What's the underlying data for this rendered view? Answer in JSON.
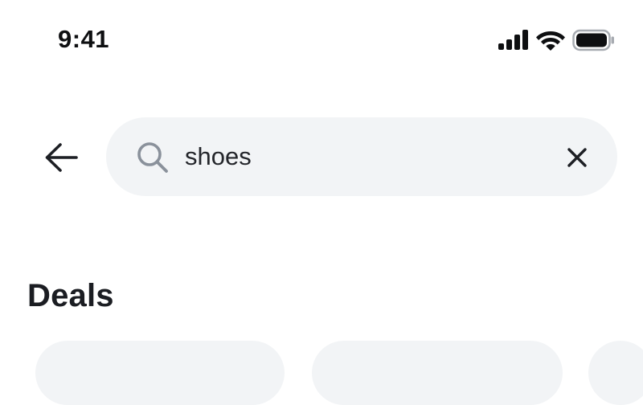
{
  "status_bar": {
    "time": "9:41",
    "icons": [
      "cellular-signal-icon",
      "wifi-icon",
      "battery-icon"
    ]
  },
  "search": {
    "query": "shoes",
    "icons": {
      "back": "back-arrow-icon",
      "search": "search-icon",
      "clear": "close-icon"
    }
  },
  "deals": {
    "title": "Deals"
  },
  "colors": {
    "search_bg": "#f2f4f6",
    "search_icon": "#8a919b",
    "text": "#1d1f24"
  }
}
